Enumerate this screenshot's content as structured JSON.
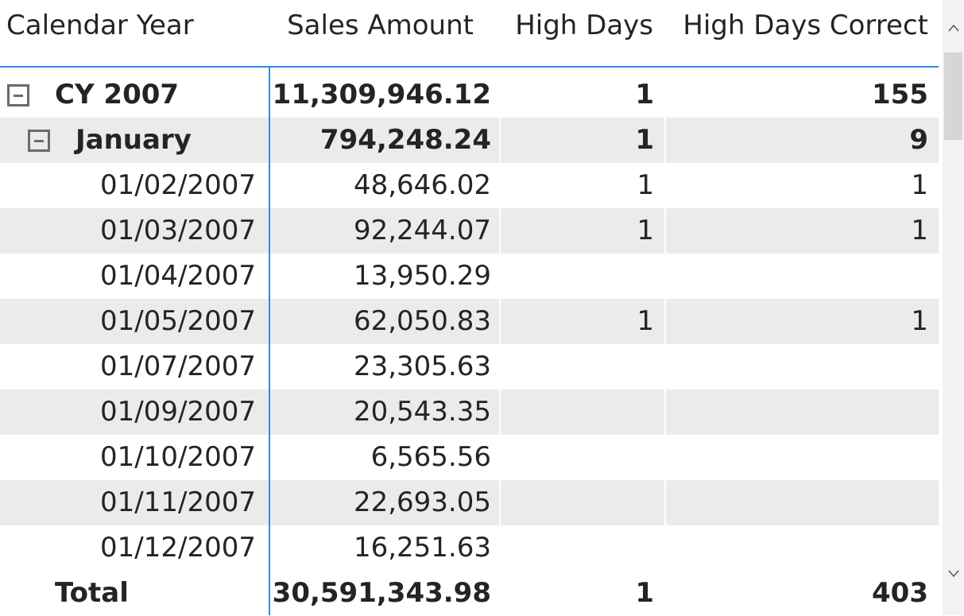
{
  "headers": {
    "year": "Calendar Year",
    "sales": "Sales Amount",
    "high": "High Days",
    "correct": "High Days Correct"
  },
  "year_row": {
    "label": "CY 2007",
    "sales": "11,309,946.12",
    "high": "1",
    "correct": "155"
  },
  "month_row": {
    "label": "January",
    "sales": "794,248.24",
    "high": "1",
    "correct": "9"
  },
  "rows": [
    {
      "date": "01/02/2007",
      "sales": "48,646.02",
      "high": "1",
      "correct": "1"
    },
    {
      "date": "01/03/2007",
      "sales": "92,244.07",
      "high": "1",
      "correct": "1"
    },
    {
      "date": "01/04/2007",
      "sales": "13,950.29",
      "high": "",
      "correct": ""
    },
    {
      "date": "01/05/2007",
      "sales": "62,050.83",
      "high": "1",
      "correct": "1"
    },
    {
      "date": "01/07/2007",
      "sales": "23,305.63",
      "high": "",
      "correct": ""
    },
    {
      "date": "01/09/2007",
      "sales": "20,543.35",
      "high": "",
      "correct": ""
    },
    {
      "date": "01/10/2007",
      "sales": "6,565.56",
      "high": "",
      "correct": ""
    },
    {
      "date": "01/11/2007",
      "sales": "22,693.05",
      "high": "",
      "correct": ""
    },
    {
      "date": "01/12/2007",
      "sales": "16,251.63",
      "high": "",
      "correct": ""
    }
  ],
  "total_row": {
    "label": "Total",
    "sales": "30,591,343.98",
    "high": "1",
    "correct": "403"
  },
  "scrollbar": {
    "up_icon": "chevron-up-icon",
    "down_icon": "chevron-down-icon"
  },
  "colors": {
    "accent": "#2e8be6",
    "alt_row": "#ebebeb",
    "text": "#252423"
  }
}
